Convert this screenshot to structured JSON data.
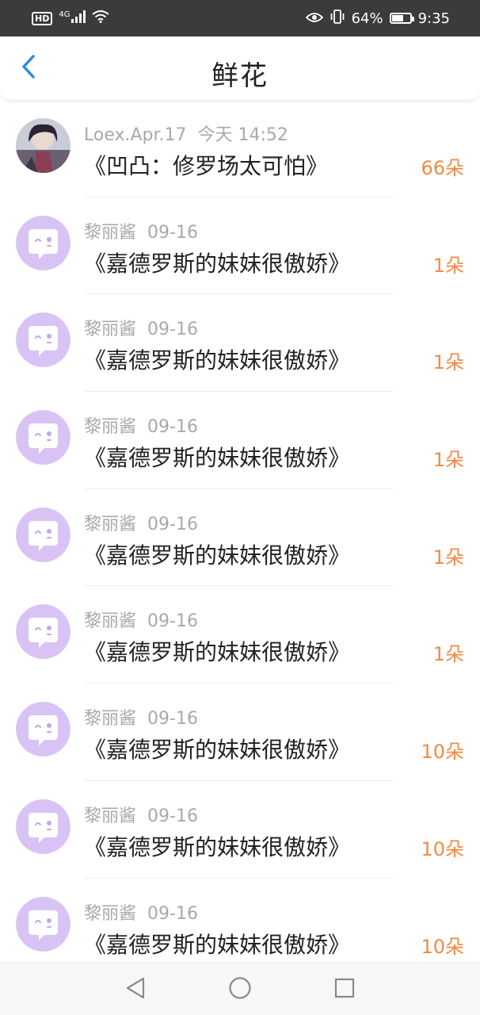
{
  "status_bar": {
    "left_badge": "HD",
    "network": "4G",
    "battery_percent": "64%",
    "time": "9:35",
    "icons": [
      "signal-icon",
      "wifi-icon",
      "eye-icon",
      "vibrate-icon",
      "battery-icon"
    ]
  },
  "header": {
    "title": "鲜花",
    "back_icon": "chevron-left-icon"
  },
  "items": [
    {
      "user": "Loex.Apr.17",
      "date": "今天 14:52",
      "book": "《凹凸：修罗场太可怕》",
      "count": "66朵",
      "avatar": "photo"
    },
    {
      "user": "黎丽酱",
      "date": "09-16",
      "book": "《嘉德罗斯的妹妹很傲娇》",
      "count": "1朵",
      "avatar": "default"
    },
    {
      "user": "黎丽酱",
      "date": "09-16",
      "book": "《嘉德罗斯的妹妹很傲娇》",
      "count": "1朵",
      "avatar": "default"
    },
    {
      "user": "黎丽酱",
      "date": "09-16",
      "book": "《嘉德罗斯的妹妹很傲娇》",
      "count": "1朵",
      "avatar": "default"
    },
    {
      "user": "黎丽酱",
      "date": "09-16",
      "book": "《嘉德罗斯的妹妹很傲娇》",
      "count": "1朵",
      "avatar": "default"
    },
    {
      "user": "黎丽酱",
      "date": "09-16",
      "book": "《嘉德罗斯的妹妹很傲娇》",
      "count": "1朵",
      "avatar": "default"
    },
    {
      "user": "黎丽酱",
      "date": "09-16",
      "book": "《嘉德罗斯的妹妹很傲娇》",
      "count": "10朵",
      "avatar": "default"
    },
    {
      "user": "黎丽酱",
      "date": "09-16",
      "book": "《嘉德罗斯的妹妹很傲娇》",
      "count": "10朵",
      "avatar": "default"
    },
    {
      "user": "黎丽酱",
      "date": "09-16",
      "book": "《嘉德罗斯的妹妹很傲娇》",
      "count": "10朵",
      "avatar": "default"
    }
  ],
  "nav_bar": {
    "buttons": [
      "back-triangle-icon",
      "home-circle-icon",
      "recents-square-icon"
    ]
  },
  "colors": {
    "accent": "#f28a45",
    "back_arrow": "#2b8be6",
    "avatar_bg": "#d9c3f5",
    "status_bar_bg": "#3b3b3b"
  }
}
